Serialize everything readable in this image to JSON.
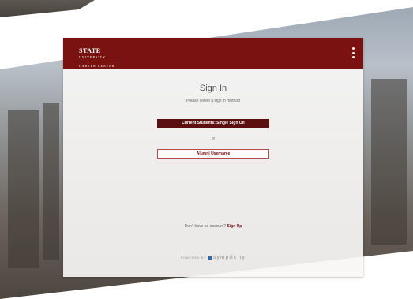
{
  "header": {
    "logo_line1": "STATE",
    "logo_line2": "UNIVERSITY",
    "logo_line3": "CAREER CENTER",
    "bg_color": "#7a1212",
    "menu_icon": "more-vertical-icon"
  },
  "signin": {
    "title": "Sign In",
    "subtitle": "Please select a sign in method",
    "primary_button": "Current Students: Single Sign On",
    "divider": "or",
    "secondary_button": "Alumni Username",
    "signup_prompt": "Don't have an account?",
    "signup_link": "Sign Up"
  },
  "footer": {
    "powered_by": "POWERED BY",
    "brand": "symplicity",
    "brand_icon": "symplicity-logo-icon"
  }
}
